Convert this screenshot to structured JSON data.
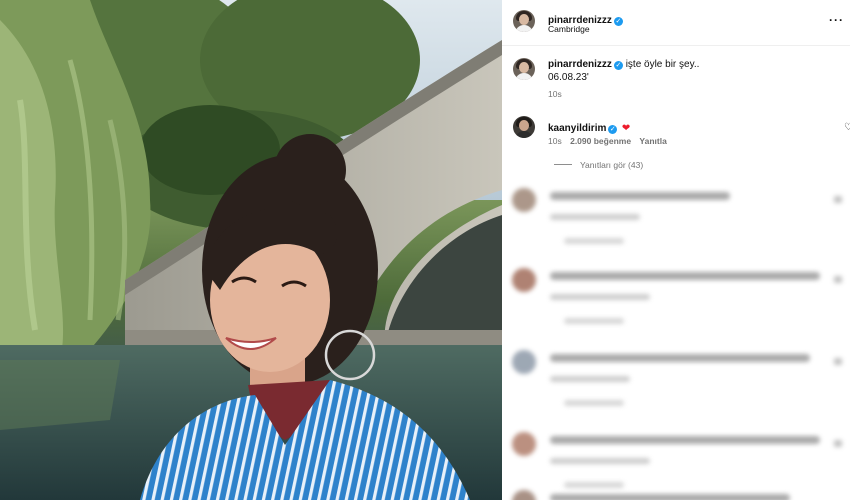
{
  "post": {
    "author": "pinarrdenizzz",
    "location": "Cambridge",
    "more_icon": "more-horizontal-icon"
  },
  "caption": {
    "author": "pinarrdenizzz",
    "text": "işte öyle bir şey..",
    "date": "06.08.23'",
    "time": "10s"
  },
  "comment": {
    "author": "kaanyildirim",
    "emoji": "❤",
    "time": "10s",
    "likes": "2.090 beğenme",
    "reply_label": "Yanıtla"
  },
  "replies": {
    "label": "Yanıtları gör (43)"
  },
  "colors": {
    "verified": "#1d9bf0",
    "heart": "#ed1c2c",
    "muted_text": "#737373"
  }
}
